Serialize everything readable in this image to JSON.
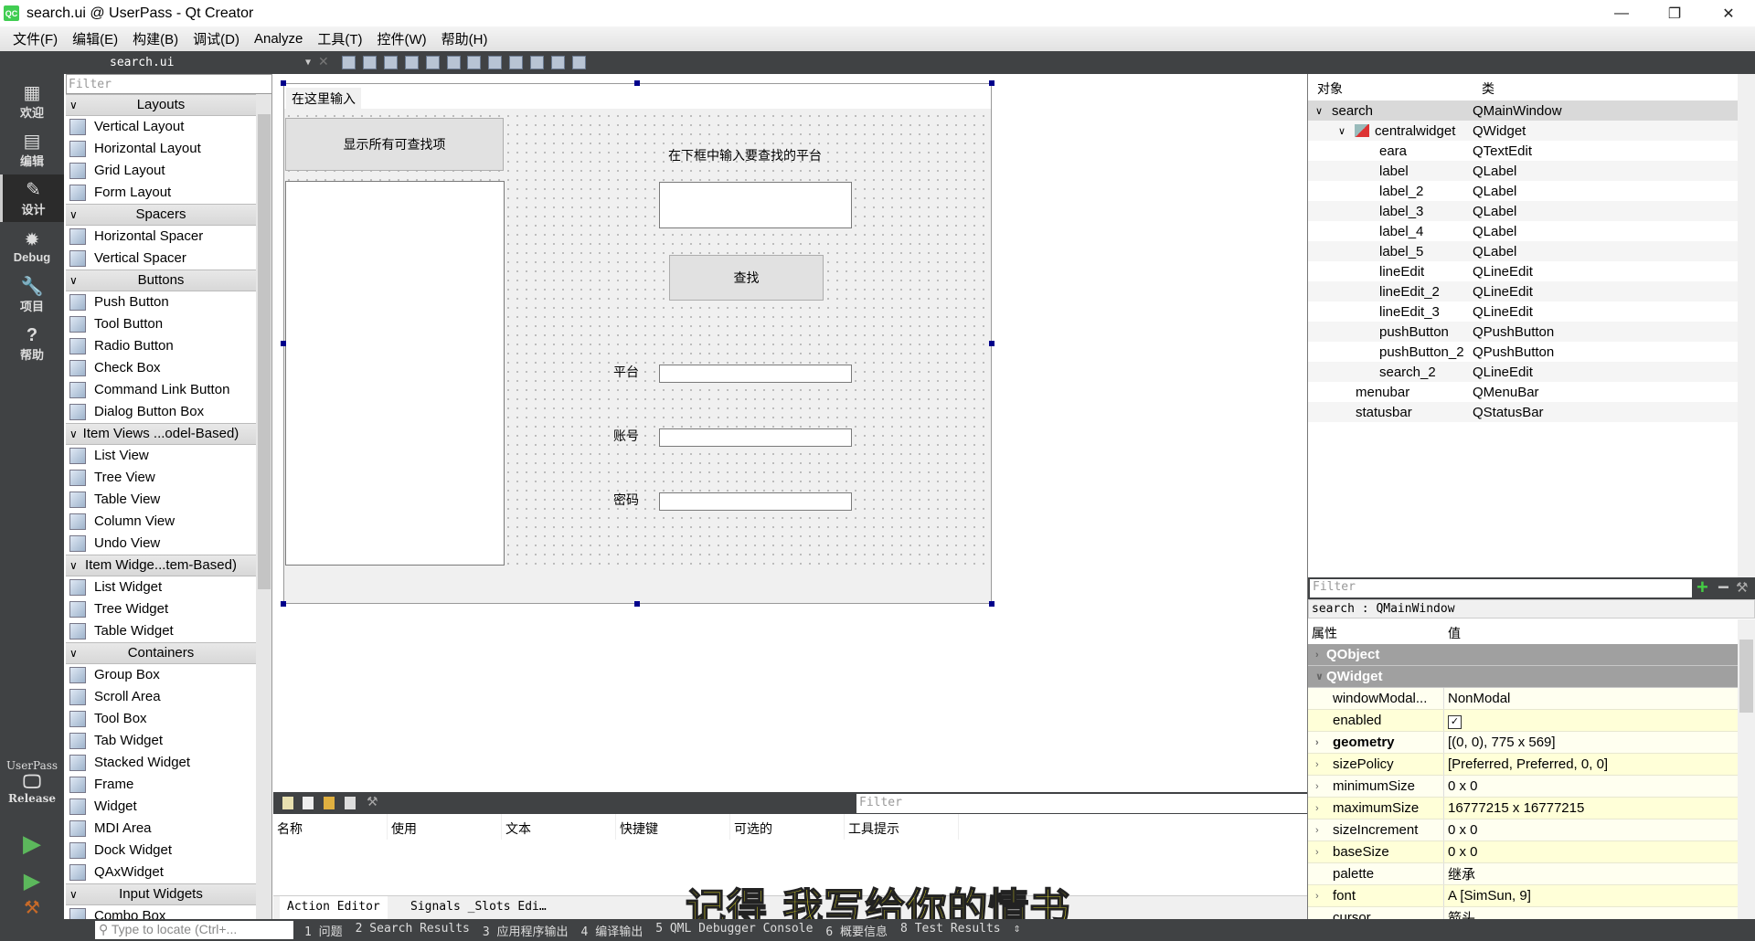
{
  "window": {
    "title": "search.ui @ UserPass - Qt Creator",
    "logo": "QC",
    "minimize": "—",
    "restore": "❐",
    "close": "✕"
  },
  "menu": [
    "文件(F)",
    "编辑(E)",
    "构建(B)",
    "调试(D)",
    "Analyze",
    "工具(T)",
    "控件(W)",
    "帮助(H)"
  ],
  "file_combo": "search.ui",
  "modes": [
    {
      "label": "欢迎",
      "icon": "grid-icon",
      "glyph": "▦"
    },
    {
      "label": "编辑",
      "icon": "document-icon",
      "glyph": "▤"
    },
    {
      "label": "设计",
      "icon": "pencil-icon",
      "glyph": "✎",
      "active": true
    },
    {
      "label": "Debug",
      "icon": "bug-icon",
      "glyph": "✹"
    },
    {
      "label": "项目",
      "icon": "wrench-icon",
      "glyph": "🔧"
    },
    {
      "label": "帮助",
      "icon": "help-icon",
      "glyph": "?"
    }
  ],
  "kit": {
    "project": "UserPass",
    "config": "Release"
  },
  "widget_box": {
    "filter_placeholder": "Filter",
    "groups": [
      {
        "title": "Layouts",
        "items": [
          "Vertical Layout",
          "Horizontal Layout",
          "Grid Layout",
          "Form Layout"
        ]
      },
      {
        "title": "Spacers",
        "items": [
          "Horizontal Spacer",
          "Vertical Spacer"
        ]
      },
      {
        "title": "Buttons",
        "items": [
          "Push Button",
          "Tool Button",
          "Radio Button",
          "Check Box",
          "Command Link Button",
          "Dialog Button Box"
        ]
      },
      {
        "title": "Item Views ...odel-Based)",
        "items": [
          "List View",
          "Tree View",
          "Table View",
          "Column View",
          "Undo View"
        ]
      },
      {
        "title": "Item Widge...tem-Based)",
        "items": [
          "List Widget",
          "Tree Widget",
          "Table Widget"
        ]
      },
      {
        "title": "Containers",
        "items": [
          "Group Box",
          "Scroll Area",
          "Tool Box",
          "Tab Widget",
          "Stacked Widget",
          "Frame",
          "Widget",
          "MDI Area",
          "Dock Widget",
          "QAxWidget"
        ]
      },
      {
        "title": "Input Widgets",
        "items": [
          "Combo Box"
        ]
      }
    ]
  },
  "form": {
    "menu_placeholder": "在这里输入",
    "show_all_button": "显示所有可查找项",
    "prompt_label": "在下框中输入要查找的平台",
    "search_button": "查找",
    "platform_label": "平台",
    "account_label": "账号",
    "password_label": "密码"
  },
  "action_editor": {
    "filter_placeholder": "Filter",
    "columns": [
      "名称",
      "使用",
      "文本",
      "快捷键",
      "可选的",
      "工具提示"
    ],
    "tabs": [
      "Action Editor",
      "Signals _Slots Edi…"
    ]
  },
  "watermark": "记得 我写给你的情书",
  "object_inspector": {
    "columns": [
      "对象",
      "类"
    ],
    "rows": [
      {
        "name": "search",
        "class": "QMainWindow",
        "level": 0,
        "expanded": true,
        "selected": true
      },
      {
        "name": "centralwidget",
        "class": "QWidget",
        "level": 1,
        "expanded": true
      },
      {
        "name": "eara",
        "class": "QTextEdit",
        "level": 2
      },
      {
        "name": "label",
        "class": "QLabel",
        "level": 2
      },
      {
        "name": "label_2",
        "class": "QLabel",
        "level": 2
      },
      {
        "name": "label_3",
        "class": "QLabel",
        "level": 2
      },
      {
        "name": "label_4",
        "class": "QLabel",
        "level": 2
      },
      {
        "name": "label_5",
        "class": "QLabel",
        "level": 2
      },
      {
        "name": "lineEdit",
        "class": "QLineEdit",
        "level": 2
      },
      {
        "name": "lineEdit_2",
        "class": "QLineEdit",
        "level": 2
      },
      {
        "name": "lineEdit_3",
        "class": "QLineEdit",
        "level": 2
      },
      {
        "name": "pushButton",
        "class": "QPushButton",
        "level": 2
      },
      {
        "name": "pushButton_2",
        "class": "QPushButton",
        "level": 2
      },
      {
        "name": "search_2",
        "class": "QLineEdit",
        "level": 2
      },
      {
        "name": "menubar",
        "class": "QMenuBar",
        "level": 1
      },
      {
        "name": "statusbar",
        "class": "QStatusBar",
        "level": 1
      }
    ]
  },
  "property_editor": {
    "filter_placeholder": "Filter",
    "object": "search : QMainWindow",
    "columns": [
      "属性",
      "值"
    ],
    "rows": [
      {
        "name": "QObject",
        "category": true,
        "expandable": true
      },
      {
        "name": "QWidget",
        "category": true,
        "expanded": true
      },
      {
        "name": "windowModal...",
        "value": "NonModal"
      },
      {
        "name": "enabled",
        "checked": true
      },
      {
        "name": "geometry",
        "value": "[(0, 0), 775 x 569]",
        "bold": true,
        "expandable": true
      },
      {
        "name": "sizePolicy",
        "value": "[Preferred, Preferred, 0, 0]",
        "expandable": true
      },
      {
        "name": "minimumSize",
        "value": "0 x 0",
        "expandable": true
      },
      {
        "name": "maximumSize",
        "value": "16777215 x 16777215",
        "expandable": true
      },
      {
        "name": "sizeIncrement",
        "value": "0 x 0",
        "expandable": true
      },
      {
        "name": "baseSize",
        "value": "0 x 0",
        "expandable": true
      },
      {
        "name": "palette",
        "value": "继承"
      },
      {
        "name": "font",
        "value": "A  [SimSun, 9]",
        "expandable": true
      },
      {
        "name": "cursor",
        "value": "箭头"
      }
    ]
  },
  "status_bar": {
    "locate_placeholder": "Type to locate (Ctrl+...",
    "items": [
      "1 问题",
      "2 Search Results",
      "3 应用程序输出",
      "4 编译输出",
      "5 QML Debugger Console",
      "6 概要信息",
      "8 Test Results",
      "⇕"
    ]
  }
}
